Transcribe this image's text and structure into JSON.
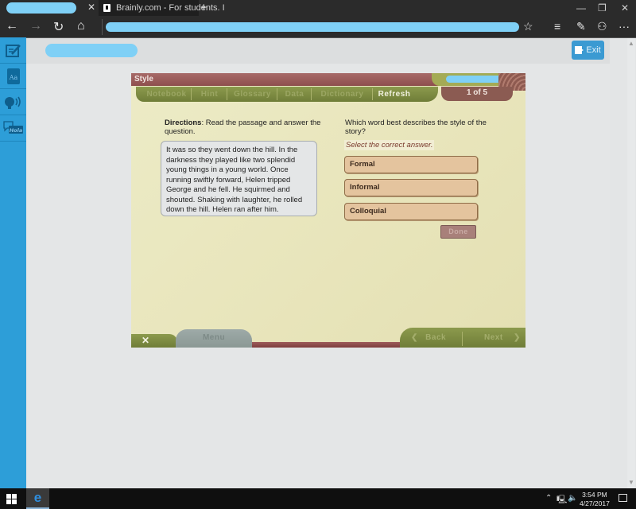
{
  "browser": {
    "tabs": [
      {
        "title": "",
        "redacted": true
      },
      {
        "title": "Brainly.com - For students. I",
        "favicon": "brainly-icon"
      }
    ],
    "new_tab_icon": "+",
    "close_tab_icon": "✕",
    "window_controls": {
      "minimize": "—",
      "restore": "❐",
      "close": "✕"
    },
    "nav": {
      "back": "←",
      "forward": "→",
      "refresh": "↻",
      "home": "⌂"
    },
    "address": {
      "value": "",
      "redacted": true
    },
    "right_icons": {
      "favorite": "☆",
      "hub": "≡",
      "web_note": "✎",
      "share": "⚇",
      "more": "···"
    }
  },
  "sidebar": {
    "items": [
      {
        "icon": "notepad-icon"
      },
      {
        "icon": "dictionary-icon",
        "label": "Aa"
      },
      {
        "icon": "text-to-speech-icon"
      },
      {
        "icon": "translate-icon",
        "label": "Hola"
      }
    ],
    "accent_color": "#2d9ed8"
  },
  "header": {
    "user_redacted": true,
    "exit_label": "Exit"
  },
  "activity": {
    "title": "Style",
    "toolbar": {
      "buttons": [
        "Notebook",
        "Hint",
        "Glossary",
        "Data",
        "Dictionary",
        "Refresh"
      ],
      "active": "Refresh"
    },
    "page_indicator": "1 of 5",
    "directions_label": "Directions",
    "directions_text": ": Read the passage and answer the question.",
    "passage": "It was so they went down the hill. In the darkness they played like two splendid young things in a young world. Once running swiftly forward, Helen tripped George and he fell. He squirmed and shouted. Shaking with laughter, he rolled down the hill. Helen ran after him.",
    "question": "Which word best describes the style of the story?",
    "instruction": "Select the correct answer.",
    "answers": [
      "Formal",
      "Informal",
      "Colloquial"
    ],
    "done_label": "Done",
    "footer": {
      "close_icon": "✕",
      "menu_label": "Menu",
      "back_label": "Back",
      "next_label": "Next",
      "back_arrow": "❮",
      "next_arrow": "❯"
    }
  },
  "taskbar": {
    "tray_up": "⌃",
    "time": "3:54 PM",
    "date": "4/27/2017"
  }
}
